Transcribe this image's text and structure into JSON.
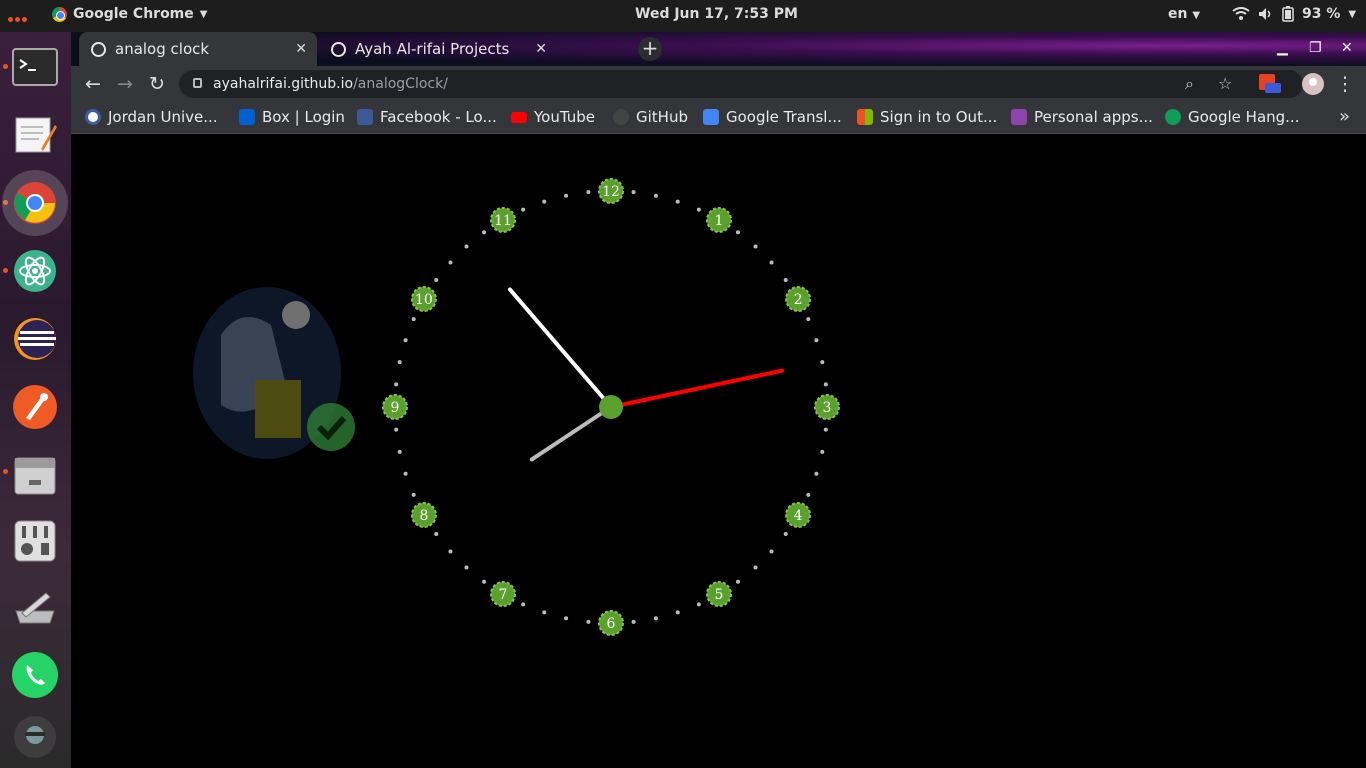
{
  "top_panel": {
    "app_name": "Google Chrome",
    "datetime": "Wed Jun 17,  7:53 PM",
    "language": "en",
    "battery": "93 %"
  },
  "dock": {
    "items": [
      "terminal",
      "text-editor",
      "chrome",
      "atom",
      "eclipse",
      "postman",
      "file-manager",
      "sound-mixer",
      "system-tools",
      "whatsapp",
      "user-avatar"
    ]
  },
  "tabs": [
    {
      "title": "analog clock",
      "active": true
    },
    {
      "title": "Ayah Al-rifai Projects",
      "active": false
    }
  ],
  "address": {
    "host": "ayahalrifai.github.io",
    "path": "/analogClock/"
  },
  "bookmarks": [
    {
      "label": "Jordan Unive...",
      "color": "#3b5ba8"
    },
    {
      "label": "Box | Login",
      "color": "#0061d5"
    },
    {
      "label": "Facebook - Lo...",
      "color": "#3b5998"
    },
    {
      "label": "YouTube",
      "color": "#ff0000"
    },
    {
      "label": "GitHub",
      "color": "#444444"
    },
    {
      "label": "Google Transl...",
      "color": "#4285f4"
    },
    {
      "label": "Sign in to Out...",
      "color": "#f25022"
    },
    {
      "label": "Personal apps...",
      "color": "#8e44ad"
    },
    {
      "label": "Google Hang...",
      "color": "#0f9d58"
    }
  ],
  "clock": {
    "numbers": [
      "12",
      "1",
      "2",
      "3",
      "4",
      "5",
      "6",
      "7",
      "8",
      "9",
      "10",
      "11"
    ],
    "time": {
      "hour": 7,
      "minute": 53,
      "second": 13
    },
    "colors": {
      "hour": "#bbbbbb",
      "minute": "#ffffff",
      "second": "#ff0000",
      "marker": "#5aa02c"
    }
  }
}
